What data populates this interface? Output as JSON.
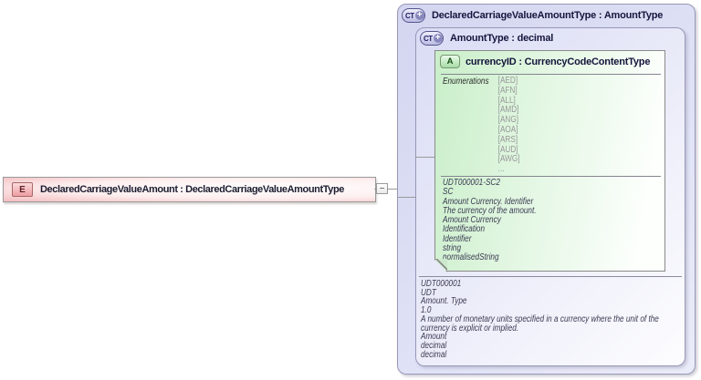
{
  "element_box": {
    "glyph": "E",
    "label": "DeclaredCarriageValueAmount : DeclaredCarriageValueAmountType"
  },
  "collapse_toggle": {
    "glyph": "−"
  },
  "outer_type_box": {
    "glyph": "CT",
    "plus_glyph": "+",
    "label": "DeclaredCarriageValueAmountType : AmountType"
  },
  "inner_type_box": {
    "glyph": "CT",
    "plus_glyph": "+",
    "label": "AmountType : decimal",
    "annotation_lines": [
      "UDT000001",
      "UDT",
      "Amount. Type",
      "1.0",
      "A number of monetary units specified in a currency where the unit of the currency is explicit or implied.",
      "Amount",
      "decimal",
      "decimal"
    ]
  },
  "attribute_box": {
    "glyph": "A",
    "label": "currencyID : CurrencyCodeContentType",
    "enumerations_label": "Enumerations",
    "enumeration_values": [
      "[AED]",
      "[AFN]",
      "[ALL]",
      "[AMD]",
      "[ANG]",
      "[AOA]",
      "[ARS]",
      "[AUD]",
      "[AWG]",
      "..."
    ],
    "annotation_lines": [
      "UDT000001-SC2",
      "SC",
      "Amount Currency. Identifier",
      "The currency of the amount.",
      "Amount Currency",
      "Identification",
      "Identifier",
      "string",
      "normalisedString"
    ]
  },
  "colors": {
    "element_pink": "#f3bcbf",
    "type_lavender": "#d6d8f2",
    "attribute_green": "#c9eec9",
    "connector_gray": "#9a9a9a"
  }
}
